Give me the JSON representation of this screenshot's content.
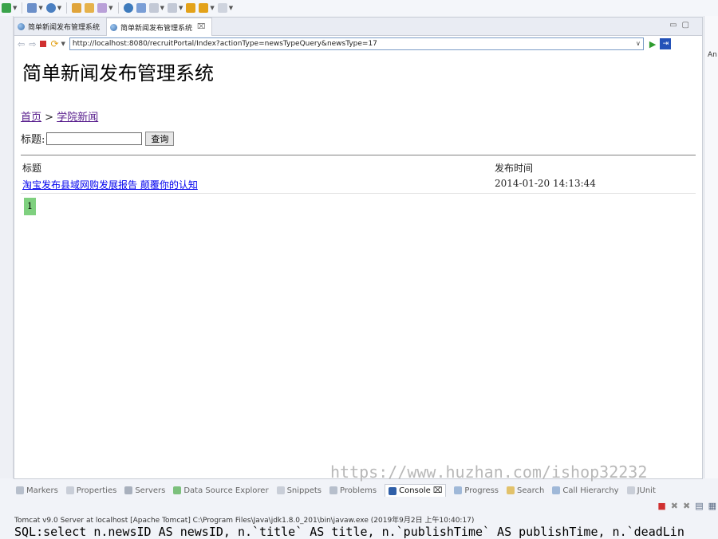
{
  "browser": {
    "tabs": [
      {
        "label": "简单新闻发布管理系统",
        "active": false
      },
      {
        "label": "简单新闻发布管理系统",
        "active": true,
        "close": "⌧"
      }
    ],
    "url": "http://localhost:8080/recruitPortal/Index?actionType=newsTypeQuery&newsType=17"
  },
  "page": {
    "title": "简单新闻发布管理系统",
    "breadcrumb": {
      "home": "首页",
      "separator": ">",
      "current": "学院新闻"
    },
    "search": {
      "label": "标题:",
      "value": "",
      "button": "查询"
    },
    "table": {
      "headers": {
        "title": "标题",
        "time": "发布时间"
      },
      "rows": [
        {
          "title": "淘宝发布县域网购发展报告 颠覆你的认知",
          "time": "2014-01-20 14:13:44"
        }
      ]
    },
    "pager": {
      "current": "1"
    },
    "watermark": "https://www.huzhan.com/ishop32232"
  },
  "right_strip": {
    "label": "An"
  },
  "bottom_panel": {
    "tabs": [
      "Markers",
      "Properties",
      "Servers",
      "Data Source Explorer",
      "Snippets",
      "Problems",
      "Console",
      "Progress",
      "Search",
      "Call Hierarchy",
      "JUnit"
    ],
    "active_tab": "Console",
    "server_info": "Tomcat v9.0 Server at localhost [Apache Tomcat] C:\\Program Files\\Java\\jdk1.8.0_201\\bin\\javaw.exe (2019年9月2日 上午10:40:17)",
    "sql": "SQL:select n.newsID AS newsID, n.`title` AS title, n.`publishTime` AS publishTime, n.`deadLin"
  },
  "colors": {
    "link_visited": "#551a8b",
    "link": "#0000ee",
    "pager_bg": "#7fd07f",
    "url_border": "#7a9cc6"
  }
}
